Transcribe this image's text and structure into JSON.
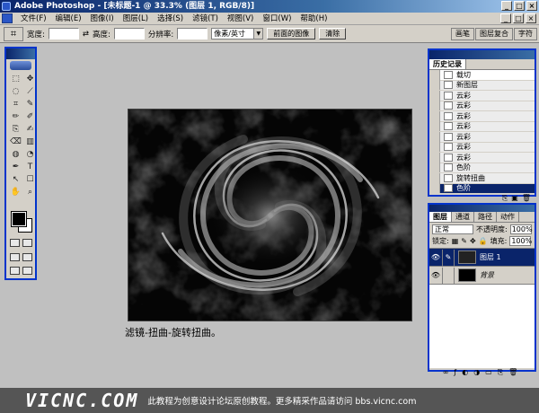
{
  "window": {
    "title": "Adobe Photoshop - [未标题-1 @ 33.3% (图层 1, RGB/8)]",
    "controls": [
      "_",
      "□",
      "×"
    ]
  },
  "menu": {
    "items": [
      "文件(F)",
      "编辑(E)",
      "图像(I)",
      "图层(L)",
      "选择(S)",
      "滤镜(T)",
      "视图(V)",
      "窗口(W)",
      "帮助(H)"
    ],
    "doc_controls": [
      "_",
      "□",
      "×"
    ]
  },
  "options": {
    "tool_icon": "crop-icon",
    "width_label": "宽度:",
    "swap_icon": "⇄",
    "height_label": "高度:",
    "resolution_label": "分辨率:",
    "unit_select": "像素/英寸",
    "front_image_button": "前面的图像",
    "clear_button": "清除",
    "palette_well_tabs": [
      "画笔",
      "图层复合",
      "字符"
    ]
  },
  "toolbox": {
    "tools": [
      "⬚",
      "✥",
      "◌",
      "⟋",
      "⌗",
      "✎",
      "✏",
      "✐",
      "⎘",
      "✍",
      "⌫",
      "▥",
      "◍",
      "◔",
      "✒",
      "T",
      "↖",
      "☐",
      "✋",
      "⌕"
    ]
  },
  "caption": "滤镜-扭曲-旋转扭曲。",
  "history": {
    "tab": "历史记录",
    "steps": [
      "载切",
      "新图层",
      "云彩",
      "云彩",
      "云彩",
      "云彩",
      "云彩",
      "云彩",
      "云彩",
      "色阶",
      "旋转扭曲",
      "色阶"
    ],
    "selected_index": 11,
    "footer_icons": [
      "⎘",
      "▣",
      "🗑"
    ]
  },
  "layers": {
    "tabs": [
      "图层",
      "通道",
      "路径",
      "动作"
    ],
    "blend_mode": "正常",
    "opacity_label": "不透明度:",
    "opacity_value": "100%",
    "lock_label": "锁定:",
    "fill_label": "填充:",
    "fill_value": "100%",
    "rows": [
      {
        "name": "图层 1",
        "eye": "👁",
        "selected": true
      },
      {
        "name": "背景",
        "eye": "👁",
        "selected": false
      }
    ],
    "footer_icons": [
      "∞",
      "ƒ",
      "◐",
      "◑",
      "▭",
      "⎘",
      "🗑"
    ]
  },
  "footer": {
    "logo": "VICNC.COM",
    "note": "此教程为创意设计论坛原创教程。更多精采作品请访问 bbs.vicnc.com"
  }
}
